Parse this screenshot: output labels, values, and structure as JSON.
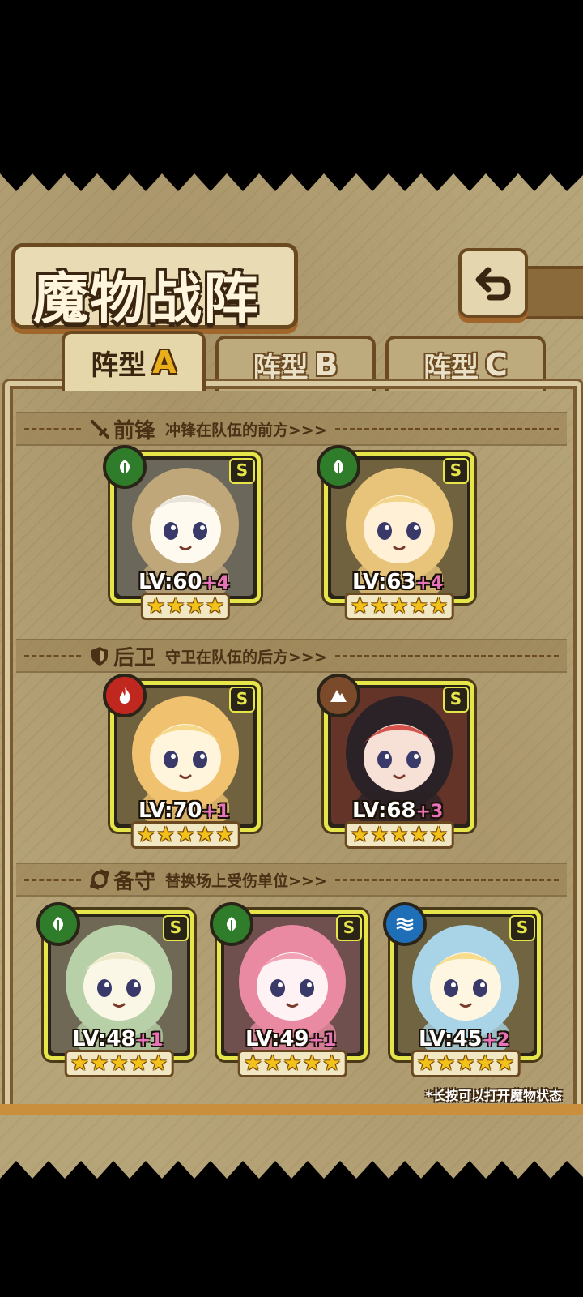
{
  "header": {
    "title": "魔物战阵",
    "back_icon": "return-arrow-icon"
  },
  "tabs": [
    {
      "label": "阵型",
      "letter": "A",
      "active": true
    },
    {
      "label": "阵型",
      "letter": "B",
      "active": false
    },
    {
      "label": "阵型",
      "letter": "C",
      "active": false
    }
  ],
  "sections": {
    "front": {
      "title": "前锋",
      "subtitle": "冲锋在队伍的前方>>>",
      "icon": "sword-icon"
    },
    "back": {
      "title": "后卫",
      "subtitle": "守卫在队伍的后方>>>",
      "icon": "shield-icon"
    },
    "reserve": {
      "title": "备守",
      "subtitle": "替换场上受伤单位>>>",
      "icon": "swap-icon"
    }
  },
  "units": {
    "front": [
      {
        "level": "LV:60",
        "plus": "+4",
        "rank": "S",
        "element": "leaf-icon",
        "element_color": "#2f7d2a",
        "stars": 4
      },
      {
        "level": "LV:63",
        "plus": "+4",
        "rank": "S",
        "element": "leaf-icon",
        "element_color": "#2f7d2a",
        "stars": 5
      }
    ],
    "back": [
      {
        "level": "LV:70",
        "plus": "+1",
        "rank": "S",
        "element": "fire-icon",
        "element_color": "#c0271f",
        "stars": 5
      },
      {
        "level": "LV:68",
        "plus": "+3",
        "rank": "S",
        "element": "mountain-icon",
        "element_color": "#7a4a2a",
        "stars": 5
      }
    ],
    "reserve": [
      {
        "level": "LV:48",
        "plus": "+1",
        "rank": "S",
        "element": "leaf-icon",
        "element_color": "#2f7d2a",
        "stars": 5
      },
      {
        "level": "LV:49",
        "plus": "+1",
        "rank": "S",
        "element": "leaf-icon",
        "element_color": "#2f7d2a",
        "stars": 5
      },
      {
        "level": "LV:45",
        "plus": "+2",
        "rank": "S",
        "element": "water-icon",
        "element_color": "#1f6fb8",
        "stars": 5
      }
    ]
  },
  "hint": "*长按可以打开魔物状态"
}
